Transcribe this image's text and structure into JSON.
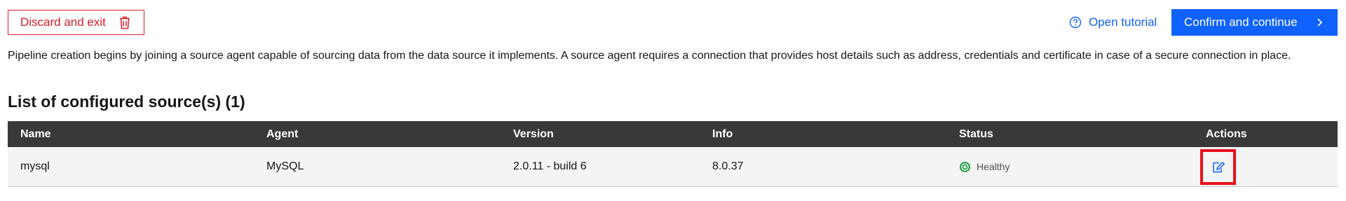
{
  "toolbar": {
    "discard_label": "Discard and exit",
    "tutorial_label": "Open tutorial",
    "confirm_label": "Confirm and continue"
  },
  "description": "Pipeline creation begins by joining a source agent capable of sourcing data from the data source it implements. A source agent requires a connection that provides host details such as address, credentials and certificate in case of a secure connection in place.",
  "list_title": "List of configured source(s) (1)",
  "table": {
    "headers": [
      "Name",
      "Agent",
      "Version",
      "Info",
      "Status",
      "Actions"
    ],
    "rows": [
      {
        "name": "mysql",
        "agent": "MySQL",
        "version": "2.0.11 - build 6",
        "info": "8.0.37",
        "status": "Healthy"
      }
    ]
  },
  "icons": {
    "discard": "trash-icon",
    "tutorial": "help-circle-icon",
    "confirm": "chevron-right-icon",
    "status": "healthy-status-icon",
    "action": "edit-icon"
  },
  "colors": {
    "primary": "#0f62fe",
    "danger": "#da1e28",
    "header_bg": "#393939",
    "row_bg": "#f4f4f4",
    "healthy": "#24a148",
    "highlight": "#e8111b"
  }
}
